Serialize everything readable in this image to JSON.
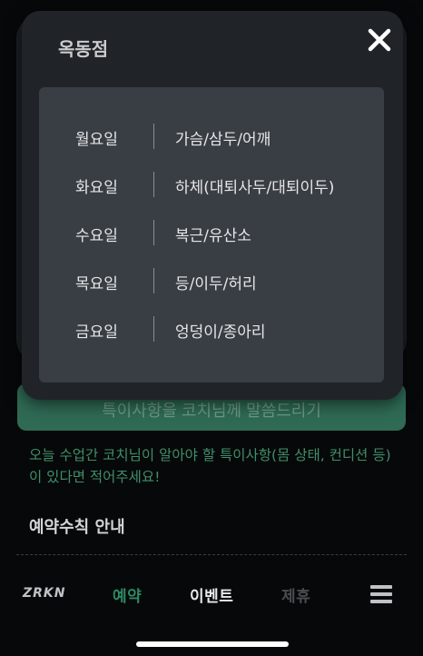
{
  "background": {
    "cta_button": "특이사항을 코치님께 말씀드리기",
    "notice": "오늘 수업간 코치님이 알아야 할 특이사항(몸 상태, 컨디션 등)이 있다면 적어주세요!",
    "rules_title": "예약수칙 안내"
  },
  "modal": {
    "title": "옥동점",
    "close_icon": "close-icon",
    "schedule": [
      {
        "day": "월요일",
        "part": "가슴/삼두/어깨"
      },
      {
        "day": "화요일",
        "part": "하체(대퇴사두/대퇴이두)"
      },
      {
        "day": "수요일",
        "part": "복근/유산소"
      },
      {
        "day": "목요일",
        "part": "등/이두/허리"
      },
      {
        "day": "금요일",
        "part": "엉덩이/종아리"
      }
    ]
  },
  "nav": {
    "logo": "ZRKN",
    "reserve": "예약",
    "event": "이벤트",
    "partner": "제휴",
    "menu_icon": "hamburger-menu-icon"
  },
  "colors": {
    "accent": "#2d8a63",
    "modal_bg": "#202428",
    "panel_bg": "#393d44"
  }
}
